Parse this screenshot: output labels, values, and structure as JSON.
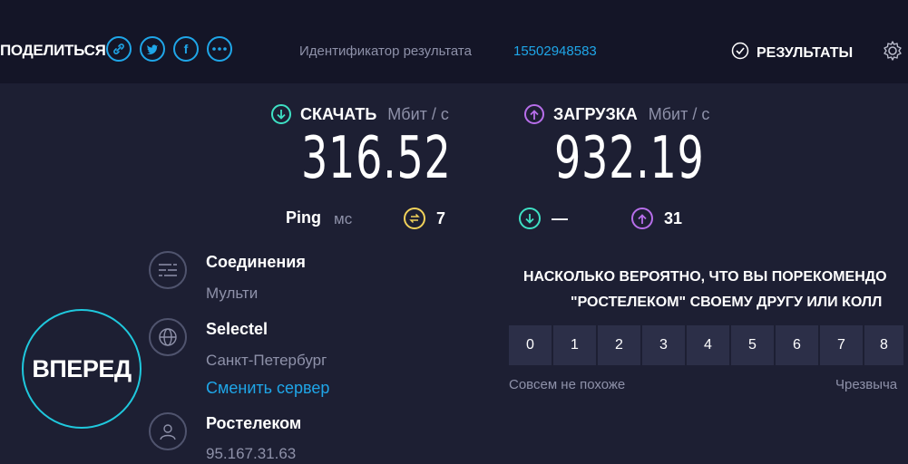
{
  "header": {
    "share_label": "ПОДЕЛИТЬСЯ",
    "share_icons": [
      "link-icon",
      "twitter-icon",
      "facebook-icon",
      "more-icon"
    ],
    "result_id_label": "Идентификатор результата",
    "result_id_value": "15502948583",
    "results_label": "РЕЗУЛЬТАТЫ"
  },
  "download": {
    "label": "СКАЧАТЬ",
    "unit": "Мбит / с",
    "value": "316.52",
    "color": "#3ee0c4"
  },
  "upload": {
    "label": "ЗАГРУЗКА",
    "unit": "Мбит / с",
    "value": "932.19",
    "color": "#b76eea"
  },
  "ping": {
    "label": "Ping",
    "unit": "мс",
    "idle": "7",
    "download": "—",
    "upload": "31",
    "idle_color": "#f2d25a"
  },
  "connections": {
    "title": "Соединения",
    "value": "Мульти"
  },
  "server": {
    "name": "Selectel",
    "location": "Санкт-Петербург",
    "change_label": "Сменить сервер"
  },
  "provider": {
    "name": "Ростелеком",
    "ip": "95.167.31.63"
  },
  "go_button": "ВПЕРЕД",
  "survey": {
    "line1": "НАСКОЛЬКО ВЕРОЯТНО, ЧТО ВЫ ПОРЕКОМЕНДО",
    "line2": "\"РОСТЕЛЕКОМ\" СВОЕМУ ДРУГУ ИЛИ КОЛЛ",
    "ratings": [
      "0",
      "1",
      "2",
      "3",
      "4",
      "5",
      "6",
      "7",
      "8"
    ],
    "low_label": "Совсем не похоже",
    "high_label": "Чрезвыча"
  },
  "colors": {
    "accent": "#1fa6e8",
    "background": "#1d1f33",
    "topbar": "#141527",
    "go_ring": "#1fc8dd"
  }
}
